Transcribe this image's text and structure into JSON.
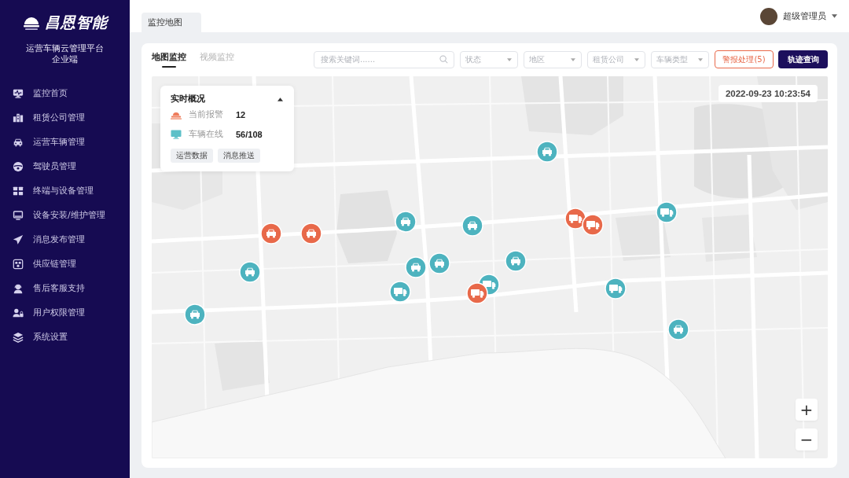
{
  "sidebar": {
    "brand": "昌恩智能",
    "platform": "运营车辆云管理平台",
    "edition": "企业端",
    "items": [
      "监控首页",
      "租赁公司管理",
      "运营车辆管理",
      "驾驶员管理",
      "终端与设备管理",
      "设备安装/维护管理",
      "消息发布管理",
      "供应链管理",
      "售后客服支持",
      "用户权限管理",
      "系统设置"
    ]
  },
  "header": {
    "tabs": [
      {
        "label": "监控地图",
        "selected": true
      }
    ],
    "user": {
      "name": "超级管理员"
    }
  },
  "content": {
    "tabs": [
      {
        "label": "地图监控",
        "selected": true
      },
      {
        "label": "视频监控",
        "selected": false
      }
    ],
    "search": {
      "placeholder": "搜索关键词......"
    },
    "filters": [
      {
        "placeholder": "状态"
      },
      {
        "placeholder": "地区"
      },
      {
        "placeholder": "租赁公司"
      },
      {
        "placeholder": "车辆类型"
      }
    ],
    "buttons": [
      {
        "label": "警报处理(5)",
        "kind": "warning"
      },
      {
        "label": "轨迹查询",
        "kind": "primary"
      }
    ]
  },
  "map": {
    "overview": {
      "title": "实时概况",
      "expanded": true,
      "stats": [
        {
          "kind": "alarm",
          "label": "当前报警",
          "value": "12"
        },
        {
          "kind": "online",
          "label": "车辆在线",
          "value": "56/108"
        }
      ],
      "buttons": [
        "运营数据",
        "消息推送"
      ]
    },
    "timestamp": "2022-09-23 10:23:54",
    "markers": [
      {
        "kind": "car",
        "alarm": false
      },
      {
        "kind": "truck",
        "alarm": false
      },
      {
        "kind": "truck",
        "alarm": true
      },
      {
        "kind": "truck",
        "alarm": true
      },
      {
        "kind": "car",
        "alarm": false
      },
      {
        "kind": "car",
        "alarm": false
      },
      {
        "kind": "car",
        "alarm": true
      },
      {
        "kind": "car",
        "alarm": true
      },
      {
        "kind": "car",
        "alarm": false
      },
      {
        "kind": "car",
        "alarm": false
      },
      {
        "kind": "car",
        "alarm": false
      },
      {
        "kind": "car",
        "alarm": false
      },
      {
        "kind": "truck",
        "alarm": false
      },
      {
        "kind": "truck",
        "alarm": true
      },
      {
        "kind": "truck",
        "alarm": false
      },
      {
        "kind": "truck",
        "alarm": false
      },
      {
        "kind": "car",
        "alarm": false
      },
      {
        "kind": "car",
        "alarm": false
      }
    ],
    "zoom": [
      "+",
      "−"
    ]
  }
}
